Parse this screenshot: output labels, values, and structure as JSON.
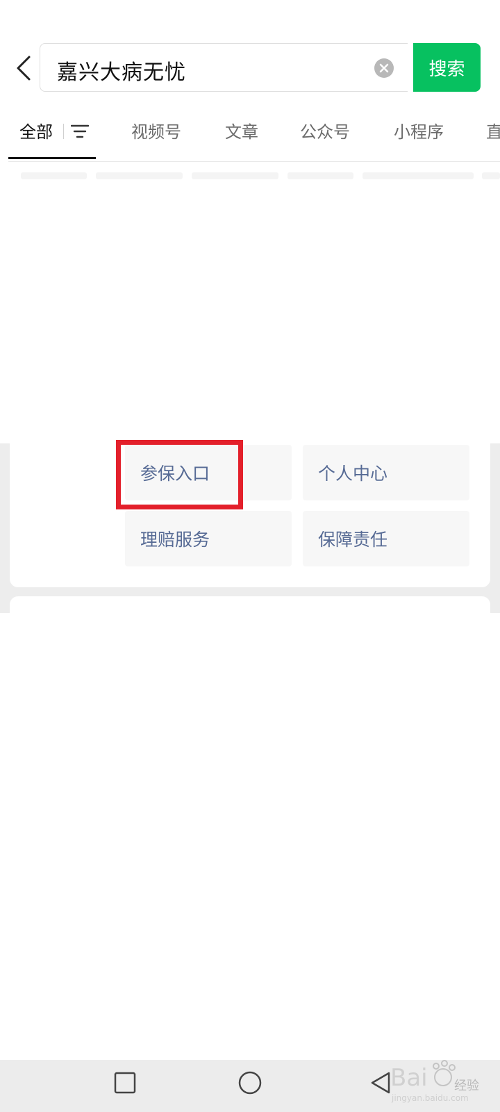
{
  "search": {
    "query": "嘉兴大病无忧",
    "button_label": "搜索"
  },
  "tabs": [
    {
      "label": "全部"
    },
    {
      "label": "视频号"
    },
    {
      "label": "文章"
    },
    {
      "label": "公众号"
    },
    {
      "label": "小程序"
    },
    {
      "label": "直"
    }
  ],
  "services": [
    {
      "label": "参保入口"
    },
    {
      "label": "个人中心"
    },
    {
      "label": "理赔服务"
    },
    {
      "label": "保障责任"
    }
  ],
  "watermark": {
    "text": "经验"
  },
  "colors": {
    "accent": "#07c160",
    "link": "#576b95",
    "highlight": "#e3202b"
  },
  "icons": [
    "back-arrow-icon",
    "clear-icon",
    "filter-icon",
    "square-icon",
    "circle-icon",
    "triangle-back-icon"
  ]
}
